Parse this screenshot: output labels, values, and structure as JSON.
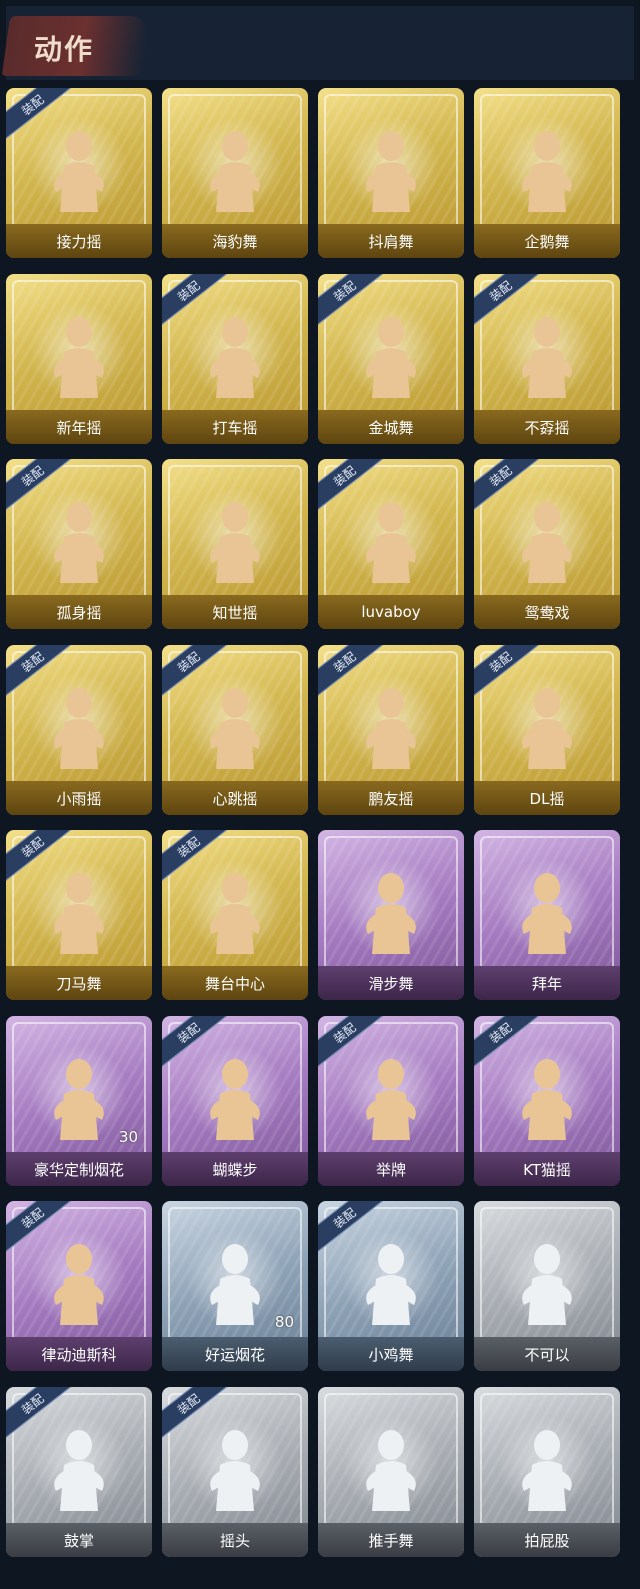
{
  "header": {
    "title": "动作"
  },
  "badge_label": "装配",
  "colors": {
    "gold": "#d2b64e",
    "purple": "#a47ac0",
    "blue": "#8ea2b6",
    "gray": "#a8adb3",
    "figure_gold": "#e9c596",
    "figure_silver": "#eef1f4"
  },
  "items": [
    {
      "label": "接力摇",
      "rarity": "gold",
      "equipped": true,
      "count": ""
    },
    {
      "label": "海豹舞",
      "rarity": "gold",
      "equipped": false,
      "count": ""
    },
    {
      "label": "抖肩舞",
      "rarity": "gold",
      "equipped": false,
      "count": ""
    },
    {
      "label": "企鹅舞",
      "rarity": "gold",
      "equipped": false,
      "count": ""
    },
    {
      "label": "新年摇",
      "rarity": "gold",
      "equipped": false,
      "count": ""
    },
    {
      "label": "打车摇",
      "rarity": "gold",
      "equipped": true,
      "count": ""
    },
    {
      "label": "金城舞",
      "rarity": "gold",
      "equipped": true,
      "count": ""
    },
    {
      "label": "不孬摇",
      "rarity": "gold",
      "equipped": true,
      "count": ""
    },
    {
      "label": "孤身摇",
      "rarity": "gold",
      "equipped": true,
      "count": ""
    },
    {
      "label": "知世摇",
      "rarity": "gold",
      "equipped": false,
      "count": ""
    },
    {
      "label": "luvaboy",
      "rarity": "gold",
      "equipped": true,
      "count": ""
    },
    {
      "label": "鸳鸯戏",
      "rarity": "gold",
      "equipped": true,
      "count": ""
    },
    {
      "label": "小雨摇",
      "rarity": "gold",
      "equipped": true,
      "count": ""
    },
    {
      "label": "心跳摇",
      "rarity": "gold",
      "equipped": true,
      "count": ""
    },
    {
      "label": "鹏友摇",
      "rarity": "gold",
      "equipped": true,
      "count": ""
    },
    {
      "label": "DL摇",
      "rarity": "gold",
      "equipped": true,
      "count": ""
    },
    {
      "label": "刀马舞",
      "rarity": "gold",
      "equipped": true,
      "count": ""
    },
    {
      "label": "舞台中心",
      "rarity": "gold",
      "equipped": true,
      "count": ""
    },
    {
      "label": "滑步舞",
      "rarity": "purple",
      "equipped": false,
      "count": ""
    },
    {
      "label": "拜年",
      "rarity": "purple",
      "equipped": false,
      "count": ""
    },
    {
      "label": "豪华定制烟花",
      "rarity": "purple",
      "equipped": false,
      "count": "30"
    },
    {
      "label": "蝴蝶步",
      "rarity": "purple",
      "equipped": true,
      "count": ""
    },
    {
      "label": "举牌",
      "rarity": "purple",
      "equipped": true,
      "count": ""
    },
    {
      "label": "KT猫摇",
      "rarity": "purple",
      "equipped": true,
      "count": ""
    },
    {
      "label": "律动迪斯科",
      "rarity": "purple",
      "equipped": true,
      "count": ""
    },
    {
      "label": "好运烟花",
      "rarity": "blue",
      "equipped": false,
      "count": "80"
    },
    {
      "label": "小鸡舞",
      "rarity": "blue",
      "equipped": true,
      "count": ""
    },
    {
      "label": "不可以",
      "rarity": "gray",
      "equipped": false,
      "count": ""
    },
    {
      "label": "鼓掌",
      "rarity": "gray",
      "equipped": true,
      "count": ""
    },
    {
      "label": "摇头",
      "rarity": "gray",
      "equipped": true,
      "count": ""
    },
    {
      "label": "推手舞",
      "rarity": "gray",
      "equipped": false,
      "count": ""
    },
    {
      "label": "拍屁股",
      "rarity": "gray",
      "equipped": false,
      "count": ""
    }
  ]
}
